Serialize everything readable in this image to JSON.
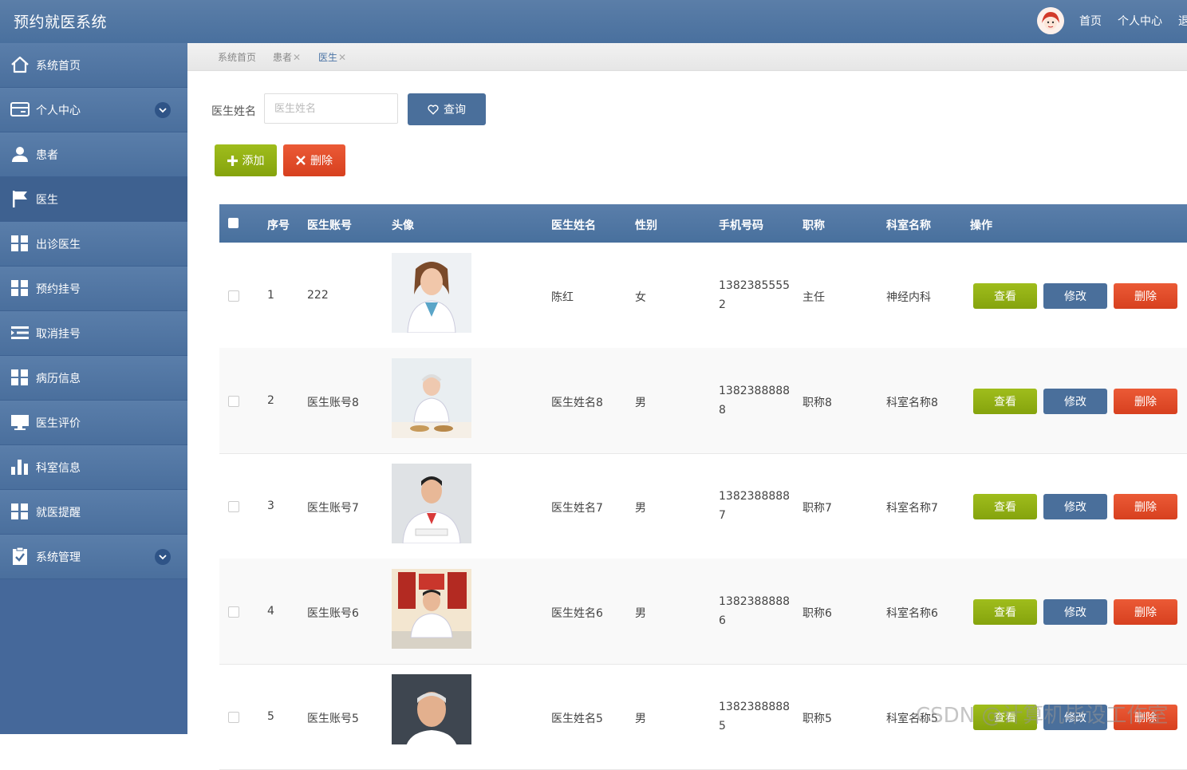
{
  "app": {
    "title": "预约就医系统"
  },
  "top_nav": [
    {
      "label": "首页"
    },
    {
      "label": "个人中心"
    },
    {
      "label": "退"
    }
  ],
  "sidebar": {
    "items": [
      {
        "label": "系统首页",
        "icon": "home-icon"
      },
      {
        "label": "个人中心",
        "icon": "card-icon",
        "expandable": true
      },
      {
        "label": "患者",
        "icon": "user-icon"
      },
      {
        "label": "医生",
        "icon": "flag-icon",
        "active": true
      },
      {
        "label": "出诊医生",
        "icon": "grid-icon"
      },
      {
        "label": "预约挂号",
        "icon": "grid-icon"
      },
      {
        "label": "取消挂号",
        "icon": "list-indent-icon"
      },
      {
        "label": "病历信息",
        "icon": "grid-icon"
      },
      {
        "label": "医生评价",
        "icon": "monitor-icon"
      },
      {
        "label": "科室信息",
        "icon": "bar-chart-icon"
      },
      {
        "label": "就医提醒",
        "icon": "grid-icon"
      },
      {
        "label": "系统管理",
        "icon": "clipboard-check-icon",
        "expandable": true
      }
    ]
  },
  "breadcrumb": [
    {
      "label": "系统首页",
      "closable": false
    },
    {
      "label": "患者",
      "closable": true
    },
    {
      "label": "医生",
      "closable": true,
      "current": true
    }
  ],
  "search": {
    "label": "医生姓名",
    "placeholder": "医生姓名",
    "value": "",
    "button": "查询"
  },
  "toolbar": {
    "add": "添加",
    "delete": "删除"
  },
  "table": {
    "headers": {
      "index": "序号",
      "account": "医生账号",
      "avatar": "头像",
      "name": "医生姓名",
      "gender": "性别",
      "phone": "手机号码",
      "title": "职称",
      "dept": "科室名称",
      "ops": "操作"
    },
    "actions": {
      "view": "查看",
      "edit": "修改",
      "delete": "删除"
    },
    "rows": [
      {
        "index": "1",
        "account": "222",
        "name": "陈红",
        "gender": "女",
        "phone_l1": "1382385555",
        "phone_l2": "2",
        "title": "主任",
        "dept": "神经内科"
      },
      {
        "index": "2",
        "account": "医生账号8",
        "name": "医生姓名8",
        "gender": "男",
        "phone_l1": "1382388888",
        "phone_l2": "8",
        "title": "职称8",
        "dept": "科室名称8"
      },
      {
        "index": "3",
        "account": "医生账号7",
        "name": "医生姓名7",
        "gender": "男",
        "phone_l1": "1382388888",
        "phone_l2": "7",
        "title": "职称7",
        "dept": "科室名称7"
      },
      {
        "index": "4",
        "account": "医生账号6",
        "name": "医生姓名6",
        "gender": "男",
        "phone_l1": "1382388888",
        "phone_l2": "6",
        "title": "职称6",
        "dept": "科室名称6"
      },
      {
        "index": "5",
        "account": "医生账号5",
        "name": "医生姓名5",
        "gender": "男",
        "phone_l1": "1382388888",
        "phone_l2": "5",
        "title": "职称5",
        "dept": "科室名称5"
      }
    ]
  },
  "watermark": "CSDN @计算机毕设工作室",
  "colors": {
    "header_blue": "#4a6f9b",
    "green": "#8fae12",
    "red": "#e04b28"
  }
}
